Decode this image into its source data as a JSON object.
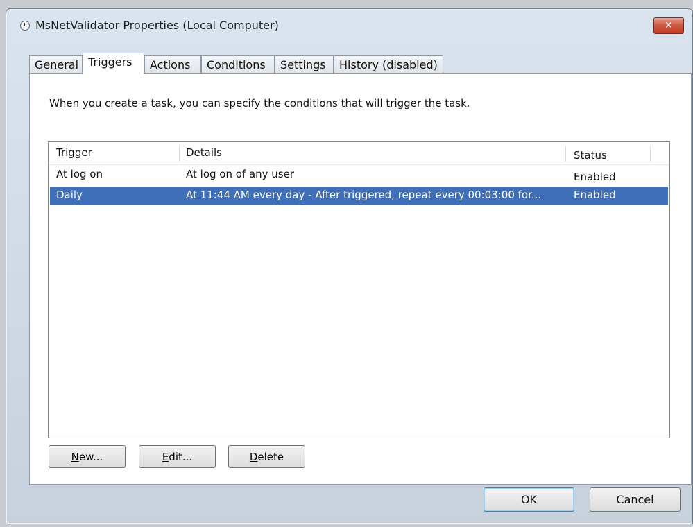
{
  "window": {
    "title": "MsNetValidator Properties (Local Computer)",
    "close_glyph": "✕"
  },
  "tabs": [
    {
      "label": "General"
    },
    {
      "label": "Triggers",
      "active": true
    },
    {
      "label": "Actions"
    },
    {
      "label": "Conditions"
    },
    {
      "label": "Settings"
    },
    {
      "label": "History (disabled)"
    }
  ],
  "triggers_panel": {
    "intro": "When you create a task, you can specify the conditions that will trigger the task.",
    "columns": [
      "Trigger",
      "Details",
      "Status"
    ],
    "rows": [
      {
        "trigger": "At log on",
        "details": "At log on of any user",
        "status": "Enabled",
        "selected": false
      },
      {
        "trigger": "Daily",
        "details": "At 11:44 AM every day - After triggered, repeat every 00:03:00 for...",
        "status": "Enabled",
        "selected": true
      }
    ],
    "buttons": {
      "new_accel": "N",
      "new_rest": "ew...",
      "edit_accel": "E",
      "edit_rest": "dit...",
      "delete_accel": "D",
      "delete_rest": "elete"
    }
  },
  "dialog_buttons": {
    "ok": "OK",
    "cancel": "Cancel"
  },
  "colors": {
    "selection": "#3f6fb8",
    "close_button": "#c23a22"
  }
}
